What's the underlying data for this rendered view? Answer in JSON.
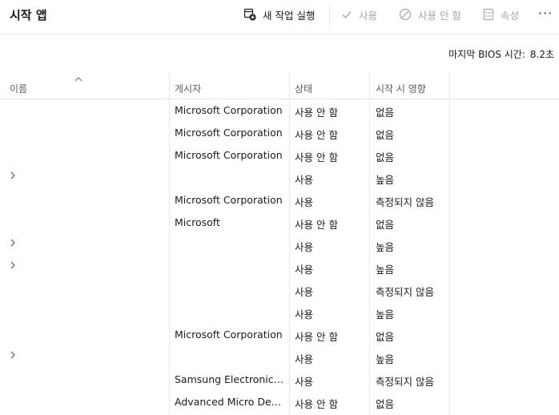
{
  "window": {
    "title": "시작 앱"
  },
  "toolbar": {
    "new_task": {
      "label": "새 작업 실행",
      "icon": "new-task-icon"
    },
    "enable": {
      "label": "사용",
      "icon": "checkmark-icon"
    },
    "disable": {
      "label": "사용 안 함",
      "icon": "block-icon"
    },
    "properties": {
      "label": "속성",
      "icon": "properties-icon"
    },
    "more": {
      "label": "···",
      "icon": "more-icon"
    }
  },
  "bios": {
    "label": "마지막 BIOS 시간:",
    "value": "8.2초"
  },
  "columns": {
    "name": "이름",
    "publisher": "게시자",
    "status": "상태",
    "impact": "시작 시 영향"
  },
  "rows": [
    {
      "expandable": false,
      "publisher": "Microsoft Corporation",
      "status": "사용 안 함",
      "impact": "없음"
    },
    {
      "expandable": false,
      "publisher": "Microsoft Corporation",
      "status": "사용 안 함",
      "impact": "없음"
    },
    {
      "expandable": false,
      "publisher": "Microsoft Corporation",
      "status": "사용 안 함",
      "impact": "없음"
    },
    {
      "expandable": true,
      "publisher": "",
      "status": "사용",
      "impact": "높음"
    },
    {
      "expandable": false,
      "publisher": "Microsoft Corporation",
      "status": "사용",
      "impact": "측정되지 않음"
    },
    {
      "expandable": false,
      "publisher": "Microsoft",
      "status": "사용 안 함",
      "impact": "없음"
    },
    {
      "expandable": true,
      "publisher": "",
      "status": "사용",
      "impact": "높음"
    },
    {
      "expandable": true,
      "publisher": "",
      "status": "사용",
      "impact": "높음"
    },
    {
      "expandable": false,
      "publisher": "",
      "status": "사용",
      "impact": "측정되지 않음"
    },
    {
      "expandable": false,
      "publisher": "",
      "status": "사용",
      "impact": "높음"
    },
    {
      "expandable": false,
      "publisher": "Microsoft Corporation",
      "status": "사용 안 함",
      "impact": "없음"
    },
    {
      "expandable": true,
      "publisher": "",
      "status": "사용",
      "impact": "높음"
    },
    {
      "expandable": false,
      "publisher": "Samsung Electronics C...",
      "status": "사용",
      "impact": "측정되지 않음"
    },
    {
      "expandable": false,
      "publisher": "Advanced Micro Device...",
      "status": "사용 안 함",
      "impact": "없음"
    }
  ]
}
